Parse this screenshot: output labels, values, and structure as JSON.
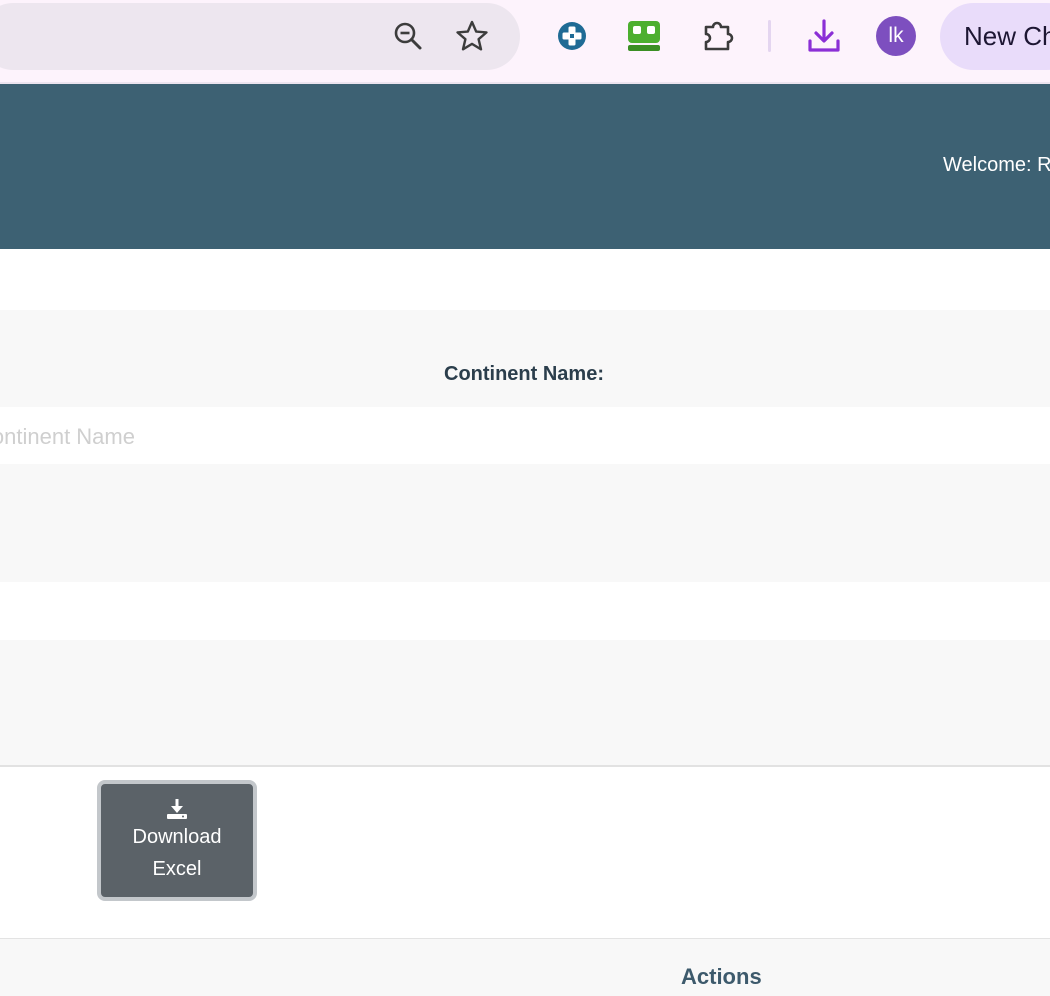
{
  "browser": {
    "zoom_icon": "zoom-out-icon",
    "bookmark_icon": "star-icon",
    "extensions": [
      "medical-cross-extension-icon",
      "robot-extension-icon",
      "puzzle-extensions-icon"
    ],
    "downloads_icon": "download-icon",
    "avatar_initials": "lk",
    "new_chat_label": "New Chat",
    "colors": {
      "toolbar": "#fdf3fc",
      "avatar": "#7d4fbf",
      "downloads": "#8b2fd6"
    }
  },
  "header": {
    "welcome_text": "Welcome: R",
    "color": "#3d6173"
  },
  "form": {
    "continent_label": "Continent Name:",
    "continent_input": {
      "value": "",
      "placeholder": "Continent Name"
    }
  },
  "actions": {
    "download_excel_line1": "Download",
    "download_excel_line2": "Excel",
    "download_icon": "download-tray-icon"
  },
  "table": {
    "headers": {
      "actions": "Actions"
    }
  }
}
